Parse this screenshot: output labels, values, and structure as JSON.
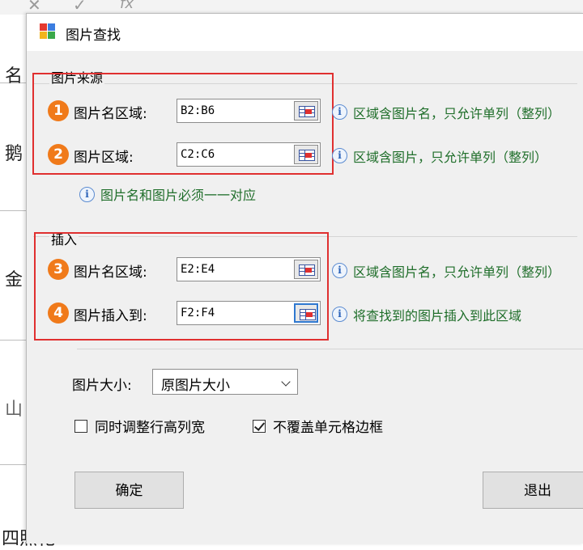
{
  "background": {
    "toolbar_icons": [
      "✕",
      "✓",
      "fx"
    ],
    "row_chars": [
      "名",
      "鹅",
      "金",
      "山",
      "四照花"
    ]
  },
  "dialog": {
    "title": "图片查找",
    "source_group": {
      "label": "图片来源",
      "fields": [
        {
          "badge": "1",
          "label": "图片名区域:",
          "value": "B2:B6",
          "hint": "区域含图片名，只允许单列（整列）"
        },
        {
          "badge": "2",
          "label": "图片区域:",
          "value": "C2:C6",
          "hint": "区域含图片，只允许单列（整列）"
        }
      ],
      "note": "图片名和图片必须一一对应"
    },
    "insert_group": {
      "label": "插入",
      "fields": [
        {
          "badge": "3",
          "label": "图片名区域:",
          "value": "E2:E4",
          "hint": "区域含图片名，只允许单列（整列）"
        },
        {
          "badge": "4",
          "label": "图片插入到:",
          "value": "F2:F4",
          "hint": "将查找到的图片插入到此区域"
        }
      ]
    },
    "size": {
      "label": "图片大小:",
      "selected": "原图片大小"
    },
    "options": [
      {
        "label": "同时调整行高列宽",
        "checked": false
      },
      {
        "label": "不覆盖单元格边框",
        "checked": true
      }
    ],
    "buttons": {
      "confirm": "确定",
      "exit": "退出"
    },
    "info_glyph": "i"
  },
  "colors": {
    "highlight": "#e03030",
    "badge": "#f07a1a",
    "hint_text": "#1f6e2a"
  }
}
